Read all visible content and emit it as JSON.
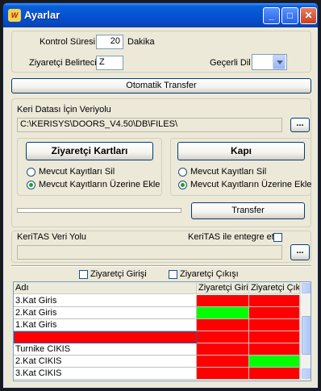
{
  "window": {
    "title": "Ayarlar",
    "app_icon_text": "W",
    "minimize": "_",
    "maximize": "□",
    "close": "✕"
  },
  "settings": {
    "kontrol_suresi_label": "Kontrol Süresi",
    "kontrol_suresi_value": "20",
    "kontrol_suresi_unit": "Dakika",
    "ziyaretci_belirteci_label": "Ziyaretçi Belirteci",
    "ziyaretci_belirteci_value": "Z",
    "gecerli_dil_label": "Geçerli Dil",
    "gecerli_dil_value": ""
  },
  "otomatik_transfer_label": "Otomatik Transfer",
  "veriyolu": {
    "label": "Keri Datası İçin Veriyolu",
    "path": "C:\\KERISYS\\DOORS_V4.50\\DB\\FILES\\",
    "browse": "..."
  },
  "ziyaretci_group": {
    "button": "Ziyaretçi Kartları",
    "option1": "Mevcut Kayıtları Sil",
    "option2": "Mevcut Kayıtların Üzerine Ekle"
  },
  "kapi_group": {
    "button": "Kapı",
    "option1": "Mevcut Kayıtları Sil",
    "option2": "Mevcut Kayıtların Üzerine Ekle"
  },
  "transfer_label": "Transfer",
  "keritas": {
    "label": "KeriTAS Veri Yolu",
    "entegre_label": "KeriTAS ile entegre et",
    "path": "",
    "browse": "..."
  },
  "filters": {
    "giris": "Ziyaretçi Girişi",
    "cikis": "Ziyaretçi Çıkışı"
  },
  "table": {
    "columns": [
      "Adı",
      "Ziyaretçi Girişi",
      "Ziyaretçi Çıkışı"
    ],
    "rows": [
      {
        "name": "3.Kat Giris",
        "giris": "red",
        "cikis": "red"
      },
      {
        "name": "2.Kat Giris",
        "giris": "green",
        "cikis": "red"
      },
      {
        "name": "1.Kat Giris",
        "giris": "red",
        "cikis": "red"
      },
      {
        "name": "",
        "giris": "red",
        "cikis": "red",
        "selected": true
      },
      {
        "name": "Turnike CIKIS",
        "giris": "red",
        "cikis": "red"
      },
      {
        "name": "2.Kat CIKIS",
        "giris": "red",
        "cikis": "green"
      },
      {
        "name": "3.Kat CIKIS",
        "giris": "red",
        "cikis": "red"
      }
    ]
  },
  "colors": {
    "red": "#ff0000",
    "green": "#00ff00",
    "selected": "#ff0000"
  }
}
